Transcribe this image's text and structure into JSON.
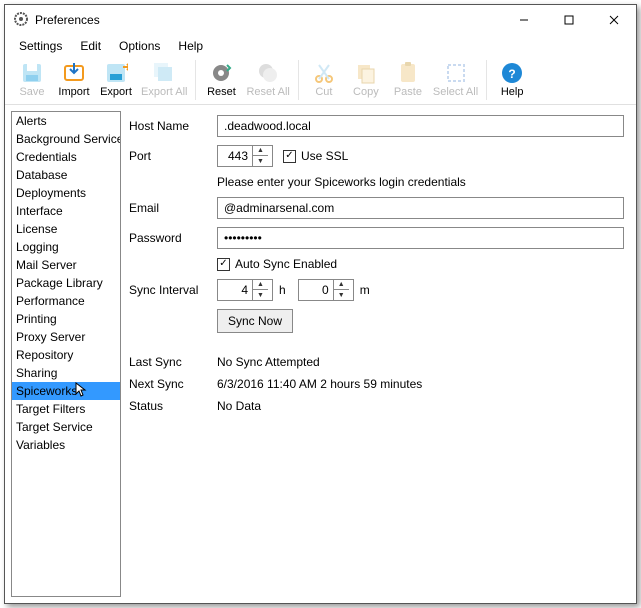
{
  "window": {
    "title": "Preferences"
  },
  "menubar": [
    "Settings",
    "Edit",
    "Options",
    "Help"
  ],
  "toolbar": {
    "save": "Save",
    "import": "Import",
    "export": "Export",
    "export_all": "Export All",
    "reset": "Reset",
    "reset_all": "Reset All",
    "cut": "Cut",
    "copy": "Copy",
    "paste": "Paste",
    "select_all": "Select All",
    "help": "Help"
  },
  "sidebar": {
    "items": [
      "Alerts",
      "Background Service",
      "Credentials",
      "Database",
      "Deployments",
      "Interface",
      "License",
      "Logging",
      "Mail Server",
      "Package Library",
      "Performance",
      "Printing",
      "Proxy Server",
      "Repository",
      "Sharing",
      "Spiceworks",
      "Target Filters",
      "Target Service",
      "Variables"
    ],
    "selected": "Spiceworks"
  },
  "form": {
    "host_name_label": "Host Name",
    "host_name_value": ".deadwood.local",
    "port_label": "Port",
    "port_value": "443",
    "use_ssl_label": "Use SSL",
    "use_ssl_checked": true,
    "credentials_hint": "Please enter your Spiceworks login credentials",
    "email_label": "Email",
    "email_value": "@adminarsenal.com",
    "password_label": "Password",
    "password_value": "•••••••••",
    "auto_sync_label": "Auto Sync Enabled",
    "auto_sync_checked": true,
    "sync_interval_label": "Sync Interval",
    "sync_hours": "4",
    "sync_minutes": "0",
    "hours_unit": "h",
    "minutes_unit": "m",
    "sync_now": "Sync Now",
    "last_sync_label": "Last Sync",
    "last_sync_value": "No Sync Attempted",
    "next_sync_label": "Next Sync",
    "next_sync_value": "6/3/2016 11:40 AM 2 hours 59 minutes",
    "status_label": "Status",
    "status_value": "No Data"
  }
}
